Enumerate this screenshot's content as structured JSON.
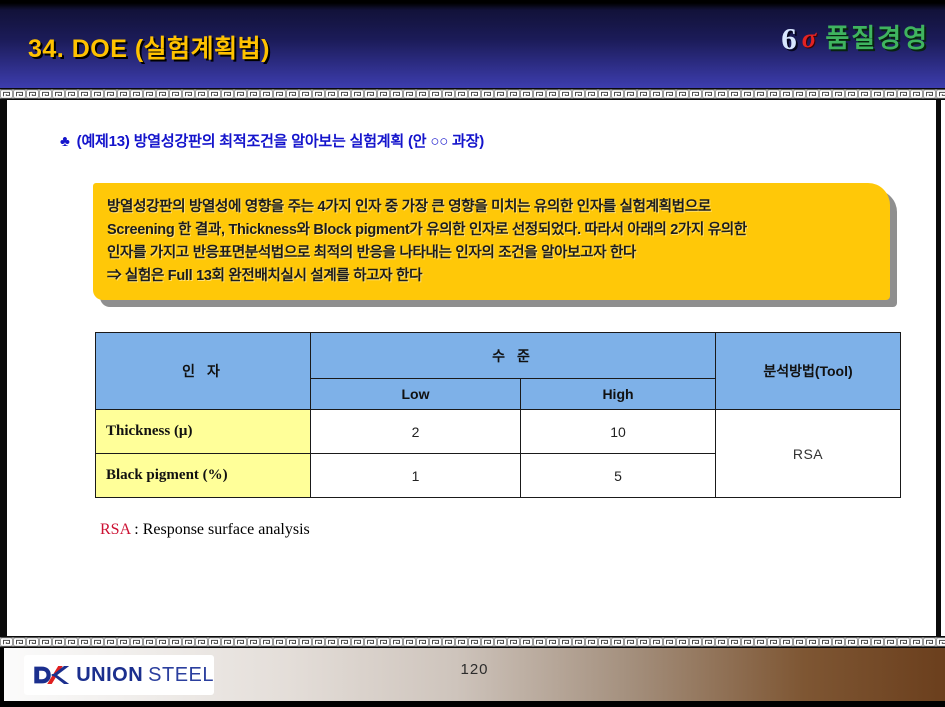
{
  "header": {
    "title": "34. DOE (실험계획법)",
    "logo": {
      "six": "6",
      "sigma": "σ",
      "brand": "품질경영"
    }
  },
  "bullet": {
    "icon": "♣",
    "text": "(예제13)  방열성강판의 최적조건을 알아보는 실험계획 (안 ○○ 과장)"
  },
  "callout": {
    "lines": [
      "방열성강판의 방열성에 영향을 주는 4가지 인자 중 가장 큰 영향을 미치는 유의한 인자를 실험계획법으로",
      "Screening 한 결과,  Thickness와 Block pigment가 유의한 인자로 선정되었다.  따라서 아래의 2가지 유의한",
      "인자를 가지고 반응표면분석법으로  최적의 반응을  나타내는 인자의 조건을 알아보고자 한다",
      "⇒ 실험은 Full 13회  완전배치실시 설계를 하고자 한다"
    ]
  },
  "table": {
    "headers": {
      "factor": "인  자",
      "level": "수  준",
      "low": "Low",
      "high": "High",
      "tool": "분석방법(Tool)"
    },
    "rows": [
      {
        "factor": "Thickness (μ)",
        "low": "2",
        "high": "10"
      },
      {
        "factor": "Black pigment (%)",
        "low": "1",
        "high": "5"
      }
    ],
    "tool_value": "RSA"
  },
  "footnote": {
    "abbr": "RSA",
    "rest": " : Response surface analysis"
  },
  "footer": {
    "union": "UNION",
    "steel": "STEEL",
    "page_number": "120"
  },
  "colors": {
    "header_navy": "#1b1b58",
    "title_gold": "#ffc200",
    "sigma_red": "#e32222",
    "brand_green": "#3fb45f",
    "callout_yellow": "#ffc808",
    "table_header_blue": "#7eb1e8",
    "factor_cell_yellow": "#ffff99",
    "footnote_red": "#cc1133",
    "footer_brown": "#6b3f1d",
    "logo_navy": "#1b2f8e",
    "logo_red": "#e02020"
  }
}
